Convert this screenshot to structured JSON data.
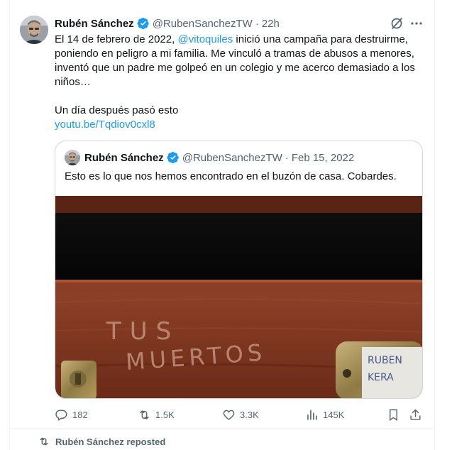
{
  "tweet": {
    "author_name": "Rubén Sánchez",
    "author_handle": "@RubenSanchezTW",
    "separator": "·",
    "time": "22h",
    "text_p1_before": "El 14 de febrero de 2022, ",
    "mention": "@vitoquiles",
    "text_p1_after": " inició una campaña para destruirme, poniendo en peligro a mi familia. Me vinculó a tramas de abusos a menores, inventó que un padre me golpeó en un colegio y me acerco demasiado a los niños…",
    "text_p2": "Un día después pasó esto",
    "link": "youtu.be/Tqdiov0cxl8"
  },
  "quote": {
    "author_name": "Rubén Sánchez",
    "author_handle": "@RubenSanchezTW",
    "separator": "·",
    "date": "Feb 15, 2022",
    "text": "Esto es lo que nos hemos encontrado en el buzón de casa. Cobardes.",
    "image_graffiti_line1": "TUS",
    "image_graffiti_line2": "MUERTOS",
    "image_label_line1": "RUBEN",
    "image_label_line2": "KERA"
  },
  "actions": {
    "replies": "182",
    "reposts": "1.5K",
    "likes": "3.3K",
    "views": "145K"
  },
  "footer": {
    "reposted_text": "Rubén Sánchez reposted"
  },
  "colors": {
    "accent": "#1d9bf0",
    "text_primary": "#0f1419",
    "text_secondary": "#536471",
    "border": "#cfd9de"
  },
  "icons": [
    "verified-badge-icon",
    "grok-icon",
    "more-icon",
    "reply-icon",
    "repost-icon",
    "like-icon",
    "views-icon",
    "bookmark-icon",
    "share-icon"
  ]
}
